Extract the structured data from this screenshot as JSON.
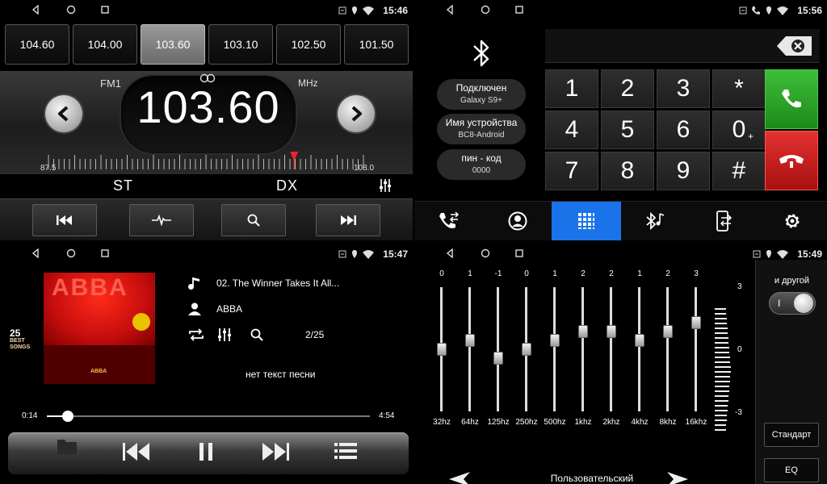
{
  "radio": {
    "time": "15:46",
    "presets": [
      "104.60",
      "104.00",
      "103.60",
      "103.10",
      "102.50",
      "101.50"
    ],
    "active_preset": 2,
    "band": "FM1",
    "unit": "MHz",
    "frequency": "103.60",
    "scale_min": "87.5",
    "scale_max": "108.0",
    "tuning_position": 0.78,
    "mode_st": "ST",
    "mode_dx": "DX"
  },
  "phone": {
    "time": "15:56",
    "info": [
      {
        "label": "Подключен",
        "value": "Galaxy S9+"
      },
      {
        "label": "Имя устройства",
        "value": "BC8-Android"
      },
      {
        "label": "пин - код",
        "value": "0000"
      }
    ],
    "keys": [
      "1",
      "2",
      "3",
      "*",
      "4",
      "5",
      "6",
      "0",
      "7",
      "8",
      "9",
      "#"
    ],
    "zero_sup": "+",
    "colors": {
      "call": "#2aa826",
      "hangup": "#d01f1f",
      "active_tab": "#1a73e8"
    },
    "tabs": [
      "call-log-icon",
      "contacts-icon",
      "dialpad-icon",
      "bluetooth-music-icon",
      "phone-transfer-icon",
      "settings-icon"
    ],
    "active_tab": 2
  },
  "music": {
    "time": "15:47",
    "track": "02. The Winner Takes It All...",
    "artist": "ABBA",
    "index": "2/25",
    "no_lyrics": "нет текст песни",
    "current_time": "0:14",
    "total_time": "4:54",
    "progress": 0.06,
    "album": {
      "title": "ABBA",
      "count": "25",
      "best_songs": "BEST SONGS",
      "logo": "ABBA"
    }
  },
  "eq": {
    "time": "15:49",
    "bands": [
      {
        "name": "32hz",
        "value": "0"
      },
      {
        "name": "64hz",
        "value": "1"
      },
      {
        "name": "125hz",
        "value": "-1"
      },
      {
        "name": "250hz",
        "value": "0"
      },
      {
        "name": "500hz",
        "value": "1"
      },
      {
        "name": "1khz",
        "value": "2"
      },
      {
        "name": "2khz",
        "value": "2"
      },
      {
        "name": "4khz",
        "value": "1"
      },
      {
        "name": "8khz",
        "value": "2"
      },
      {
        "name": "16khz",
        "value": "3"
      }
    ],
    "scale_top": "3",
    "scale_mid": "0",
    "scale_bottom": "-3",
    "preset": "Пользовательский",
    "side_title": "и другой",
    "toggle_mark": "I",
    "btn_standard": "Стандарт",
    "btn_eq": "EQ"
  }
}
